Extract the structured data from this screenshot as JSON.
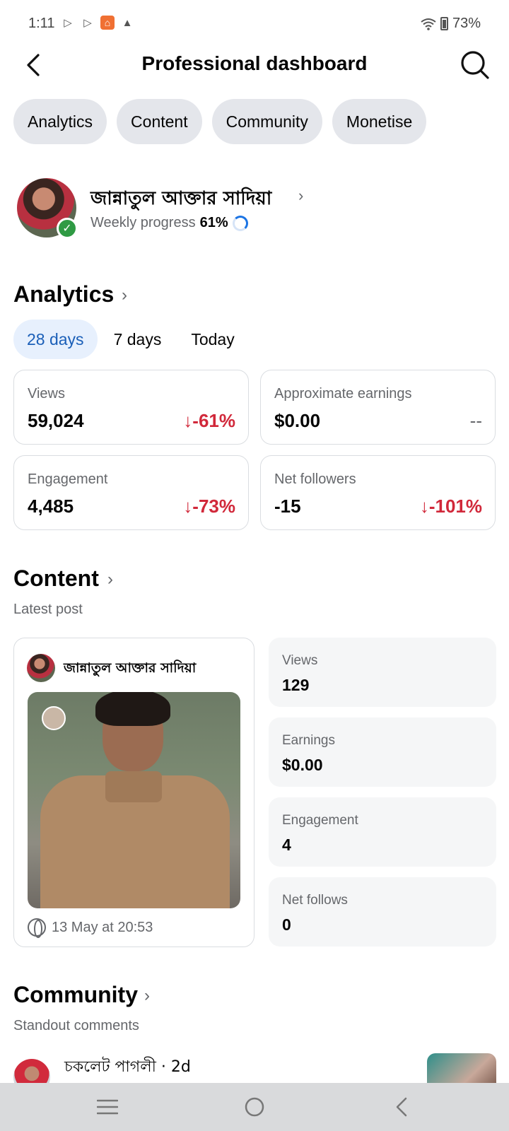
{
  "status_bar": {
    "time": "1:11",
    "battery": "73%"
  },
  "header": {
    "title": "Professional dashboard"
  },
  "chips": [
    "Analytics",
    "Content",
    "Community",
    "Monetise"
  ],
  "profile": {
    "name": "জান্নাতুল আক্তার সাদিয়া",
    "progress_label": "Weekly progress",
    "progress_value": "61%",
    "progress_fraction": 0.61
  },
  "analytics": {
    "title": "Analytics",
    "ranges": [
      "28 days",
      "7 days",
      "Today"
    ],
    "active_range": "28 days",
    "cards": [
      {
        "label": "Views",
        "value": "59,024",
        "delta": "-61%"
      },
      {
        "label": "Approximate earnings",
        "value": "$0.00",
        "delta": "--"
      },
      {
        "label": "Engagement",
        "value": "4,485",
        "delta": "-73%"
      },
      {
        "label": "Net followers",
        "value": "-15",
        "delta": "-101%"
      }
    ]
  },
  "content": {
    "title": "Content",
    "subtitle": "Latest post",
    "post": {
      "author": "জান্নাতুল আক্তার সাদিয়া",
      "timestamp": "13 May at 20:53"
    },
    "stats": [
      {
        "label": "Views",
        "value": "129"
      },
      {
        "label": "Earnings",
        "value": "$0.00"
      },
      {
        "label": "Engagement",
        "value": "4"
      },
      {
        "label": "Net follows",
        "value": "0"
      }
    ]
  },
  "community": {
    "title": "Community",
    "subtitle": "Standout comments",
    "comment": {
      "author": "চকলেট পাগলী · 2d"
    }
  },
  "colors": {
    "negative": "#d1283a",
    "accent": "#1b74e4",
    "chip_bg": "#e4e6eb"
  }
}
